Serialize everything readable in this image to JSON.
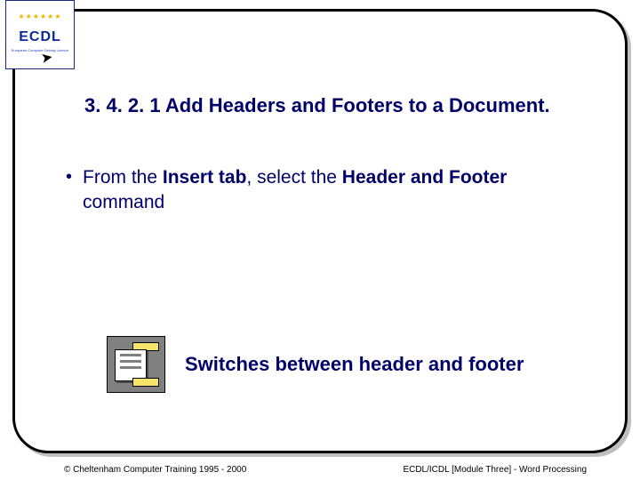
{
  "logo": {
    "acronym": "ECDL",
    "subtext": "European Computer Driving Licence"
  },
  "title": "3. 4. 2. 1 Add Headers and Footers to a Document.",
  "bullet": {
    "pre": "From the ",
    "bold1": "Insert tab",
    "mid": ", select the ",
    "bold2": "Header and Footer",
    "post": " command"
  },
  "switch_label": "Switches between header and footer",
  "footer": {
    "left": "© Cheltenham Computer Training 1995 - 2000",
    "right": "ECDL/ICDL [Module Three]  - Word Processing"
  }
}
